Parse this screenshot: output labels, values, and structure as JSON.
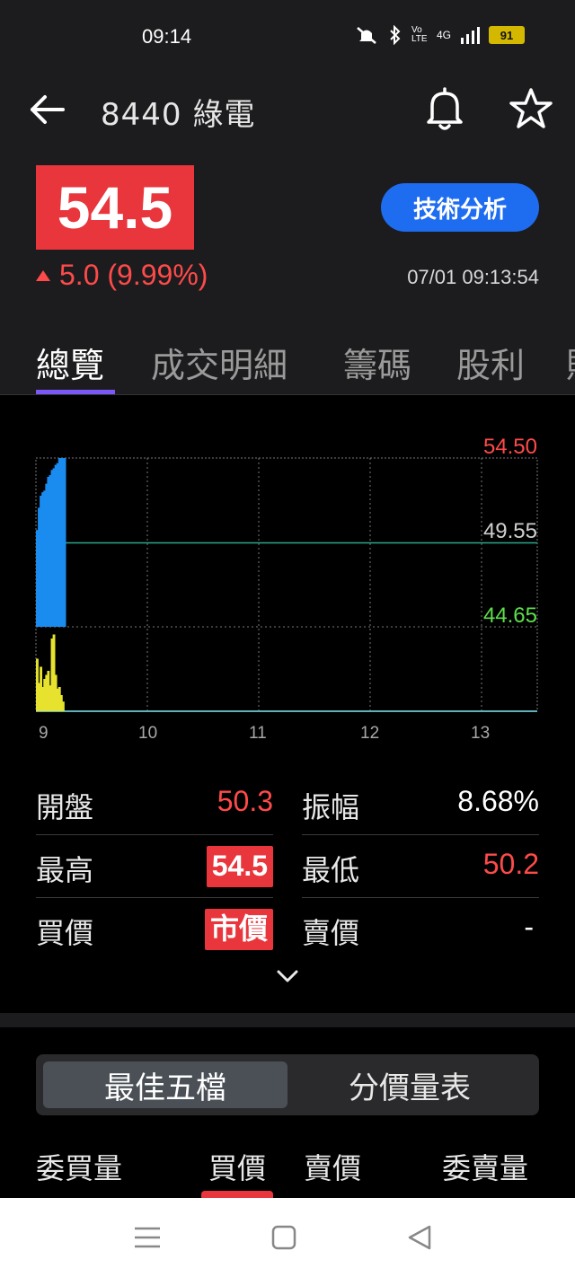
{
  "status": {
    "time": "09:14",
    "network": "4G",
    "volte": "Vo LTE",
    "battery": "91"
  },
  "header": {
    "title": "8440 綠電",
    "price": "54.5",
    "change": "5.0 (9.99%)",
    "tech_button": "技術分析",
    "timestamp": "07/01 09:13:54"
  },
  "tabs": [
    {
      "label": "總覽",
      "active": true
    },
    {
      "label": "成交明細"
    },
    {
      "label": "籌碼"
    },
    {
      "label": "股利"
    },
    {
      "label": "財"
    }
  ],
  "chart_data": {
    "type": "area",
    "y_labels": {
      "high": "54.50",
      "ref": "49.55",
      "low": "44.65"
    },
    "ylim": [
      44.65,
      54.5
    ],
    "reference": 49.55,
    "x_ticks": [
      "9",
      "10",
      "11",
      "12",
      "13"
    ],
    "price_series": {
      "x_minutes_after_9": [
        0,
        1,
        2,
        3,
        4,
        5,
        6,
        7,
        8,
        9,
        10,
        11,
        12,
        13,
        14
      ],
      "y": [
        50.3,
        51.6,
        52.3,
        52.5,
        52.6,
        53.0,
        53.4,
        53.5,
        53.8,
        53.9,
        54.1,
        54.2,
        54.5,
        54.5,
        54.5
      ]
    },
    "volume_series": {
      "x_minutes_after_9": [
        0,
        1,
        2,
        3,
        4,
        5,
        6,
        7,
        8,
        9,
        10,
        11,
        12,
        13,
        14
      ],
      "relative_volume": [
        0.65,
        0.35,
        0.55,
        0.3,
        0.4,
        0.45,
        0.5,
        0.32,
        0.9,
        0.95,
        0.45,
        0.28,
        0.3,
        0.2,
        0.12
      ]
    },
    "colors": {
      "price_fill": "#1a8cf0",
      "volume": "#e6e22e",
      "ref_line": "#2aa889",
      "high": "#ff4a4a",
      "ref": "#cfcfcf",
      "low": "#5ce04a"
    }
  },
  "stats": {
    "open_label": "開盤",
    "open_value": "50.3",
    "amplitude_label": "振幅",
    "amplitude_value": "8.68%",
    "high_label": "最高",
    "high_value": "54.5",
    "low_label": "最低",
    "low_value": "50.2",
    "bid_label": "買價",
    "bid_value": "市價",
    "ask_label": "賣價",
    "ask_value": "-"
  },
  "segment": {
    "best_five": "最佳五檔",
    "price_volume": "分價量表"
  },
  "orderbook_headers": {
    "bid_qty": "委買量",
    "bid_price": "買價",
    "ask_price": "賣價",
    "ask_qty": "委賣量"
  }
}
